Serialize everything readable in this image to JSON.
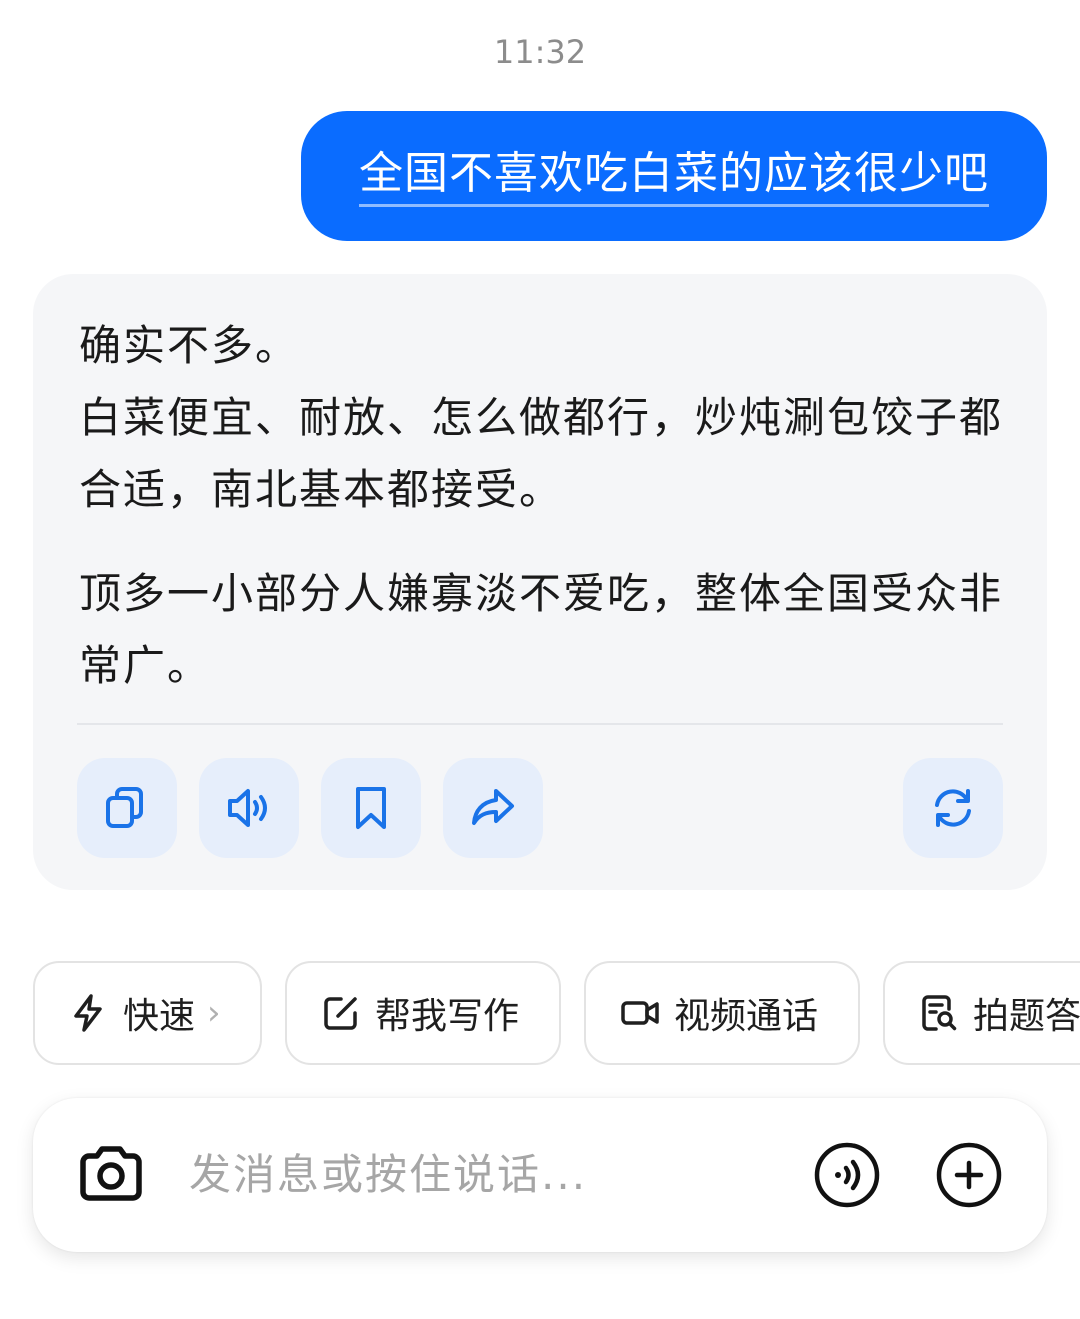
{
  "timestamp": "11:32",
  "user_message": "全国不喜欢吃白菜的应该很少吧",
  "assistant_message": {
    "paragraph_1_line_1": "确实不多。",
    "paragraph_1_line_2": "白菜便宜、耐放、怎么做都行，炒炖涮包饺子都合适，南北基本都接受。",
    "paragraph_2": "顶多一小部分人嫌寡淡不爱吃，整体全国受众非常广。"
  },
  "actions": {
    "copy": "copy-icon",
    "speak": "speaker-icon",
    "bookmark": "bookmark-icon",
    "share": "share-icon",
    "regenerate": "refresh-icon"
  },
  "chips": [
    {
      "label": "快速",
      "icon": "lightning-icon",
      "chevron": "›"
    },
    {
      "label": "帮我写作",
      "icon": "edit-icon"
    },
    {
      "label": "视频通话",
      "icon": "video-icon"
    },
    {
      "label": "拍题答疑",
      "icon": "photo-question-icon"
    }
  ],
  "input": {
    "placeholder": "发消息或按住说话..."
  },
  "colors": {
    "accent": "#0a6cff",
    "icon_blue": "#1a73e8",
    "card_bg": "#f5f6f8",
    "action_bg": "#e6eefb"
  }
}
